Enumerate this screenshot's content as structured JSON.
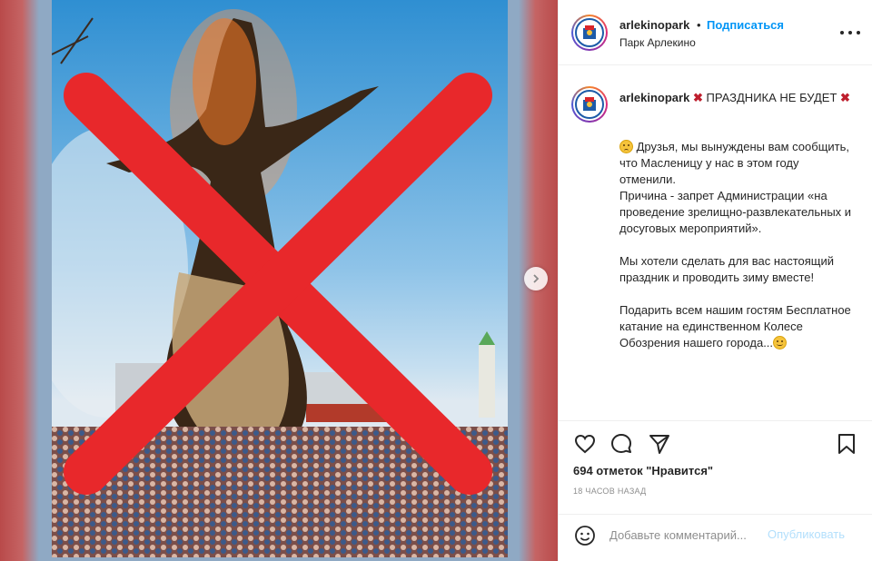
{
  "header": {
    "username": "arlekinopark",
    "separator": "•",
    "follow_label": "Подписаться",
    "location": "Парк Арлекино"
  },
  "caption": {
    "username": "arlekinopark",
    "title": "ПРАЗДНИКА НЕ БУДЕТ",
    "body": "Друзья, мы вынуждены вам сообщить, что Масленицу у нас в этом году отменили.\nПричина - запрет Администрации «на проведение зрелищно-развлекательных и досуговых мероприятий».\n\nМы хотели сделать для вас настоящий праздник и проводить зиму вместе!\n\nПодарить всем нашим гостям Бесплатное катание на единственном Колесе Обозрения нашего города..."
  },
  "actions": {
    "likes": "694 отметок \"Нравится\"",
    "time_ago": "18 часов назад"
  },
  "comment": {
    "placeholder": "Добавьте комментарий...",
    "post_label": "Опубликовать"
  },
  "icons": {
    "like": "heart-icon",
    "comment": "comment-icon",
    "share": "share-icon",
    "save": "bookmark-icon",
    "more": "more-icon",
    "next": "chevron-right-icon",
    "emoji": "emoji-icon"
  },
  "colors": {
    "follow": "#0095f6",
    "cross": "#e8282b",
    "post_disabled": "#b2dffc"
  }
}
